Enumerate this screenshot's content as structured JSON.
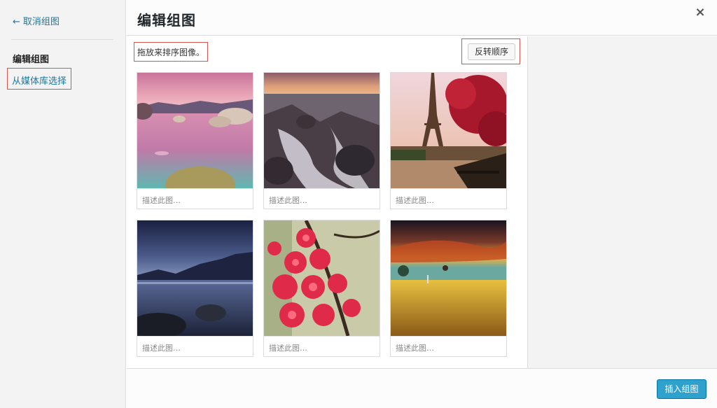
{
  "menu": {
    "cancel_arrow": "←",
    "cancel_label": "取消组图",
    "current_label": "编辑组图",
    "library_label": "从媒体库选择"
  },
  "header": {
    "title": "编辑组图",
    "close_glyph": "×"
  },
  "toolbar": {
    "hint": "拖放来排序图像。",
    "reverse_label": "反转顺序"
  },
  "gallery": {
    "items": [
      {
        "caption": "描述此图…",
        "image": "lake-sunset"
      },
      {
        "caption": "描述此图…",
        "image": "waterfall-rocks"
      },
      {
        "caption": "描述此图…",
        "image": "eiffel-tower-autumn"
      },
      {
        "caption": "描述此图…",
        "image": "mountain-lake-night"
      },
      {
        "caption": "描述此图…",
        "image": "pink-blossoms"
      },
      {
        "caption": "描述此图…",
        "image": "golden-field-sunset"
      }
    ]
  },
  "footer": {
    "insert_label": "插入组图"
  },
  "colors": {
    "link": "#21759b",
    "primary_button": "#2ea2cc",
    "highlight_border": "#d9534f"
  }
}
